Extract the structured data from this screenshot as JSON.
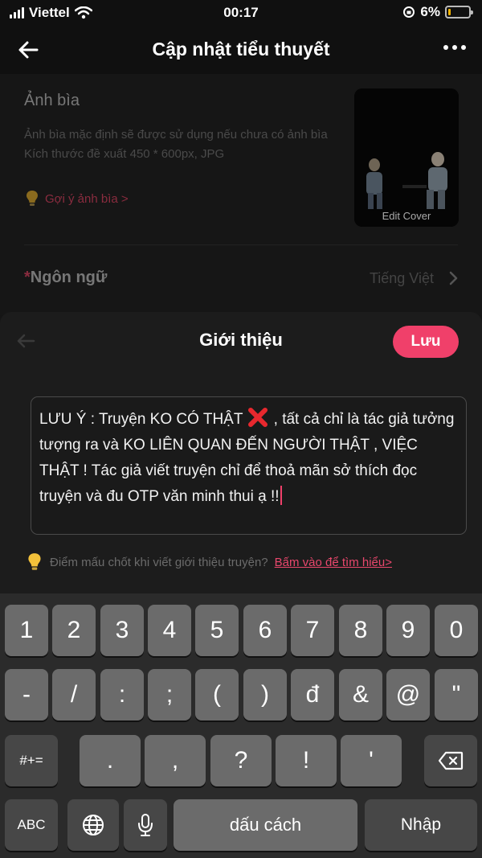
{
  "status_bar": {
    "carrier": "Viettel",
    "time": "00:17",
    "battery": "6%"
  },
  "header": {
    "title": "Cập nhật tiểu thuyết"
  },
  "form": {
    "cover_title": "Ảnh bìa",
    "cover_desc_1": "Ảnh bìa mặc định sẽ được sử dụng nếu chưa có ảnh bìa",
    "cover_desc_2": "Kích thước đề xuất 450 * 600px, JPG",
    "cover_hint": "Gợi ý ảnh bìa >",
    "edit_cover": "Edit Cover",
    "language_label": "Ngôn ngữ",
    "language_required_mark": "*",
    "language_value": "Tiếng Việt"
  },
  "intro_sheet": {
    "title": "Giới thiệu",
    "save_label": "Lưu",
    "text_before_icon": "LƯU Ý : Truyện KO CÓ THẬT ",
    "text_after_icon": " , tất cả chỉ là tác giả tưởng tượng ra và KO LIÊN QUAN ĐẾN NGƯỜI THẬT , VIỆC THẬT ! Tác giả viết truyện chỉ để thoả mãn sở thích đọc truyện và đu OTP văn minh thui ạ !!",
    "tip_text": "Điểm mấu chốt khi viết giới thiệu truyện?",
    "tip_link": "Bấm vào để tìm hiểu>"
  },
  "keyboard": {
    "row1": [
      "1",
      "2",
      "3",
      "4",
      "5",
      "6",
      "7",
      "8",
      "9",
      "0"
    ],
    "row2": [
      "-",
      "/",
      ":",
      ";",
      "(",
      ")",
      "đ",
      "&",
      "@",
      "\""
    ],
    "row3": [
      ".",
      ",",
      "?",
      "!",
      "'"
    ],
    "symbols_label": "#+=",
    "abc_label": "ABC",
    "space_label": "dấu cách",
    "enter_label": "Nhập"
  },
  "colors": {
    "accent": "#f0406a",
    "background": "#151515",
    "sheet": "#1c1c1c",
    "key": "#6b6b6b",
    "key_dark": "#474747"
  }
}
